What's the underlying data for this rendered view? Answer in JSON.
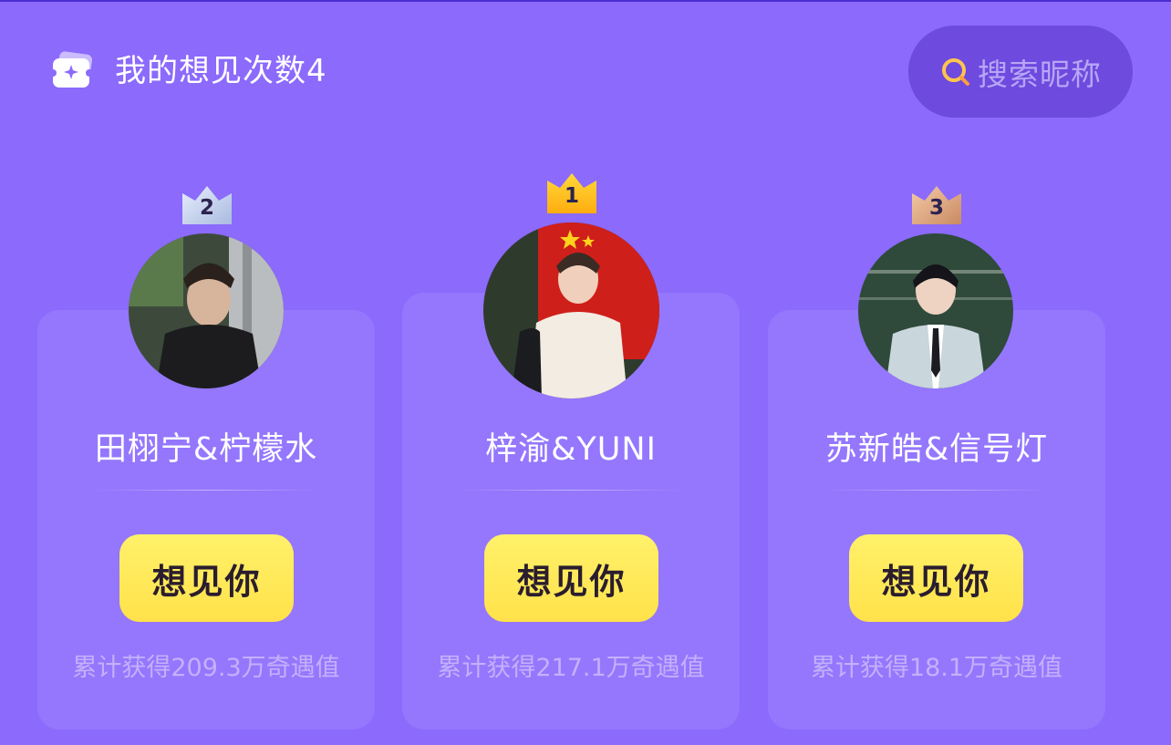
{
  "header": {
    "title": "我的想见次数4",
    "ticket_icon": "ticket-icon"
  },
  "search": {
    "placeholder": "搜索昵称",
    "icon": "search-icon"
  },
  "cards": [
    {
      "rank": "2",
      "name": "田栩宁&柠檬水",
      "button_label": "想见你",
      "stat": "累计获得209.3万奇遇值",
      "crown_color": "#c9d6ee"
    },
    {
      "rank": "1",
      "name": "梓渝&YUNI",
      "button_label": "想见你",
      "stat": "累计获得217.1万奇遇值",
      "crown_color": "#ffc21a"
    },
    {
      "rank": "3",
      "name": "苏新皓&信号灯",
      "button_label": "想见你",
      "stat": "累计获得18.1万奇遇值",
      "crown_color": "#e8b48c"
    }
  ],
  "colors": {
    "background": "#8b6afc",
    "card": "#9477fd",
    "search_bg": "#6e4adf",
    "button": "#ffe24a"
  }
}
